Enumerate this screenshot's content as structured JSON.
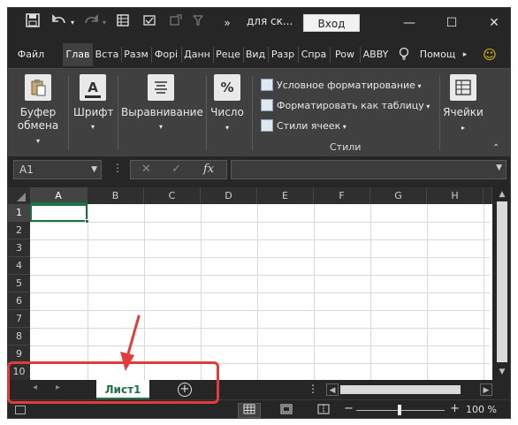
{
  "window": {
    "title": "для ск...",
    "login_label": "Вход",
    "minimize": "—",
    "maximize": "☐",
    "close": "✕"
  },
  "quick_access": {
    "save_icon": "save-icon",
    "undo_icon": "undo-icon",
    "redo_icon": "redo-icon",
    "form_icon": "form-icon",
    "customize_icon": "customize-icon",
    "more_icon": "more-commands-icon"
  },
  "tabs": [
    {
      "label": "Файл"
    },
    {
      "label": "Глав",
      "active": true
    },
    {
      "label": "Вста"
    },
    {
      "label": "Разм"
    },
    {
      "label": "Форі"
    },
    {
      "label": "Данн"
    },
    {
      "label": "Реце"
    },
    {
      "label": "Вид"
    },
    {
      "label": "Разр"
    },
    {
      "label": "Спра"
    },
    {
      "label": "Pow"
    },
    {
      "label": "ABBY"
    },
    {
      "label": "Помощ"
    }
  ],
  "ribbon": {
    "clipboard": {
      "line1": "Буфер",
      "line2": "обмена"
    },
    "font": {
      "label": "Шрифт",
      "icon_text": "A"
    },
    "alignment": {
      "label": "Выравнивание"
    },
    "number": {
      "label": "Число",
      "icon_text": "%"
    },
    "styles": {
      "conditional": "Условное форматирование",
      "as_table": "Форматировать как таблицу",
      "cell_styles": "Стили ячеек",
      "caption": "Стили"
    },
    "cells": {
      "label": "Ячейки"
    }
  },
  "formula_bar": {
    "name_box": "A1",
    "cancel": "✕",
    "enter": "✓",
    "fx": "fx",
    "content": ""
  },
  "grid": {
    "columns": [
      "A",
      "B",
      "C",
      "D",
      "E",
      "F",
      "G",
      "H"
    ],
    "rows": [
      "1",
      "2",
      "3",
      "4",
      "5",
      "6",
      "7",
      "8",
      "9",
      "10"
    ],
    "active_cell": "A1"
  },
  "sheets": {
    "tabs": [
      {
        "label": "Лист1",
        "active": true
      }
    ],
    "add_label": "+"
  },
  "status": {
    "zoom_level": "100 %",
    "zoom_fraction": 0.5
  },
  "colors": {
    "accent": "#1e7145",
    "annotation": "#e23b3b"
  }
}
